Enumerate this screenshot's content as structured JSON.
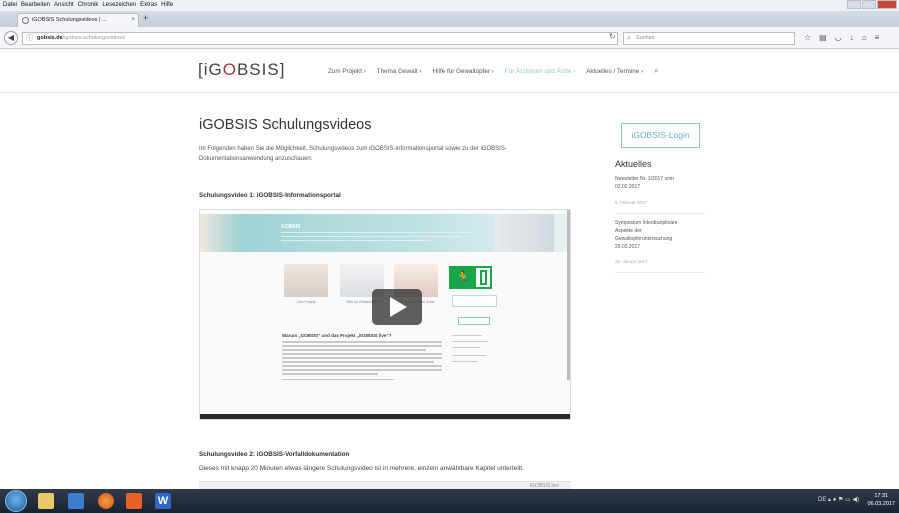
{
  "browser": {
    "menu": [
      "Datei",
      "Bearbeiten",
      "Ansicht",
      "Chronik",
      "Lesezeichen",
      "Extras",
      "Hilfe"
    ],
    "tab_title": "iGOBSIS Schulungsvideos | ...",
    "tab_close": "×",
    "new_tab": "+",
    "url_domain": "gobsis.de",
    "url_path": "/igobsis-schulungsvideos/",
    "search_placeholder": "Suchen"
  },
  "site": {
    "logo_left": "[iG",
    "logo_mark": "O",
    "logo_right": "BSIS]",
    "nav": [
      {
        "label": "Zum Projekt ›"
      },
      {
        "label": "Thema Gewalt ›"
      },
      {
        "label": "Hilfe für Gewaltopfer ›"
      },
      {
        "label": "Für Ärztinnen und Ärzte ›"
      },
      {
        "label": "Aktuelles / Termine ›"
      }
    ]
  },
  "main": {
    "title": "iGOBSIS Schulungsvideos",
    "intro": "Im Folgenden haben Sie die Möglichkeit, Schulungsvideos zum iGOBSIS-Informationsportal sowie zu der iGOBSIS-Dokumentationsanwendung anzuschauen:",
    "video1_heading": "Schulungsvideo 1: iGOBSIS-Informationsportal",
    "video1_preview": {
      "brand": "GOBSIS",
      "cards": [
        "Zum Projekt",
        "Hilfe für Gewaltopfer",
        "Für Ärztinnen und Ärzte"
      ],
      "article_heading": "Warum „GOBSIS“ und das Projekt „iGOBSIS live“?",
      "login": "iGOBSIS-Login",
      "aktuelles": "Aktuelles"
    },
    "video2_heading": "Schulungsvideo 2: iGOBSIS-Vorfalldokumentation",
    "video2_desc": "Dieses mit knapp 20 Minuten etwas längere Schulungsvideo ist in mehrere, einzeln anwählbare Kapitel unterteilt.",
    "video2_strip_text": "iGOBSIS live"
  },
  "sidebar": {
    "login": "iGOBSIS-Login",
    "heading": "Aktuelles",
    "news1": "Newsletter Nr. 1/2017 vom 02.02.2017",
    "date1": "6. Februar 2017",
    "news2": "Symposium Interdisziplinäre Aspekte der Gewaltopferuntersuchung 29.03.2017",
    "date2": "25. Januar 2017"
  },
  "taskbar": {
    "tray_lang": "DE",
    "time": "17:31",
    "date": "06.03.2017"
  },
  "colors": {
    "accent": "#8fc5c4",
    "logo_mark": "#a13a3a"
  }
}
